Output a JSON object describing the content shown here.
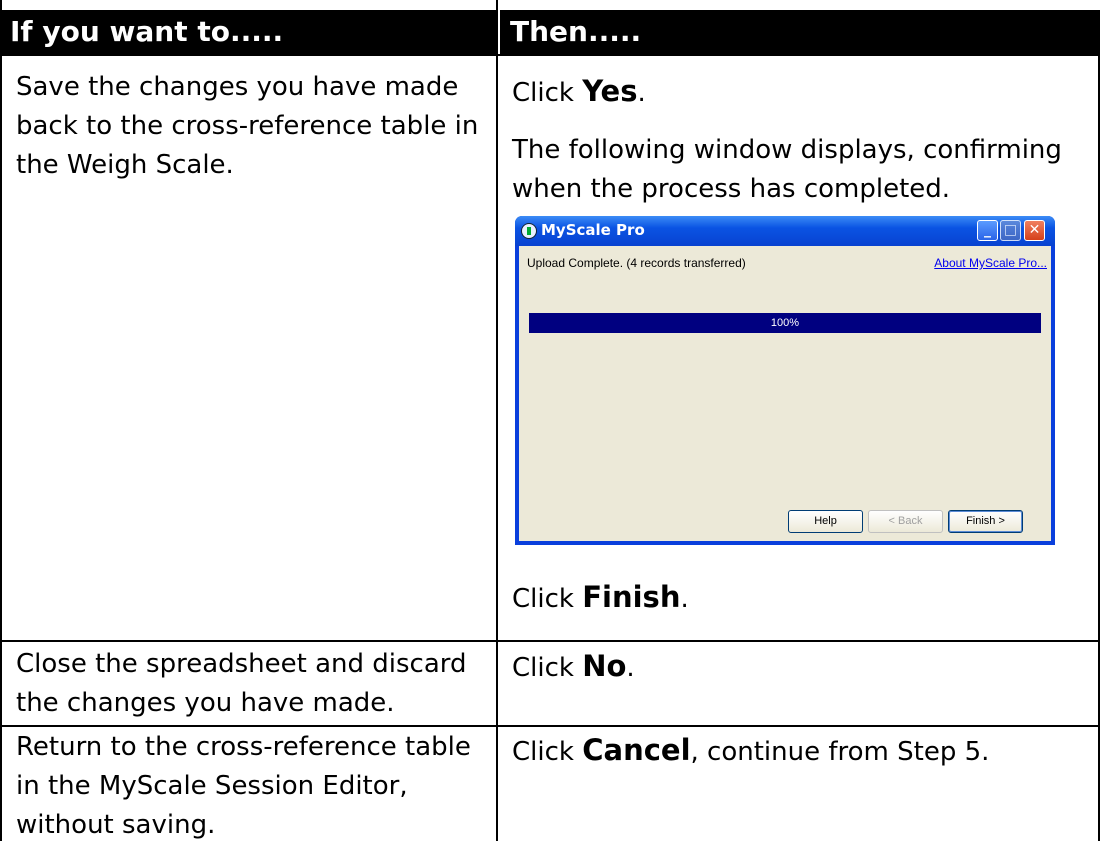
{
  "table": {
    "headers": [
      "If you want to.....",
      "Then....."
    ],
    "rows": [
      {
        "condition": [
          "Save the changes you have made",
          "back to the cross-reference table in",
          "the Weigh Scale."
        ],
        "action_prefix": "Click ",
        "action_bold": "Yes",
        "action_suffix": ".",
        "extra_lines": [
          "The following window displays, confirming",
          "when the process has completed."
        ],
        "after_prefix": "Click ",
        "after_bold": "Finish",
        "after_suffix": "."
      },
      {
        "condition": [
          "Close the spreadsheet and discard",
          "the changes you have made."
        ],
        "action_prefix": "Click ",
        "action_bold": "No",
        "action_suffix": "."
      },
      {
        "condition": [
          "Return to the cross-reference table",
          "in the MyScale Session Editor,",
          "without saving."
        ],
        "action_prefix": "Click ",
        "action_bold": "Cancel",
        "action_suffix": ", continue from Step 5."
      }
    ]
  },
  "dialog": {
    "title": "MyScale Pro",
    "status_text": "Upload Complete. (4 records transferred)",
    "about_link": "About MyScale Pro...",
    "progress_percent": 100,
    "progress_label": "100%",
    "buttons": {
      "help": "Help",
      "back": "< Back",
      "finish": "Finish >"
    },
    "icons": [
      "app-icon",
      "minimize-icon",
      "maximize-icon",
      "close-icon"
    ],
    "colors": {
      "titlebar": "#0a53e3",
      "body": "#ece9d8",
      "progress": "#000080",
      "close": "#d5401a"
    }
  }
}
